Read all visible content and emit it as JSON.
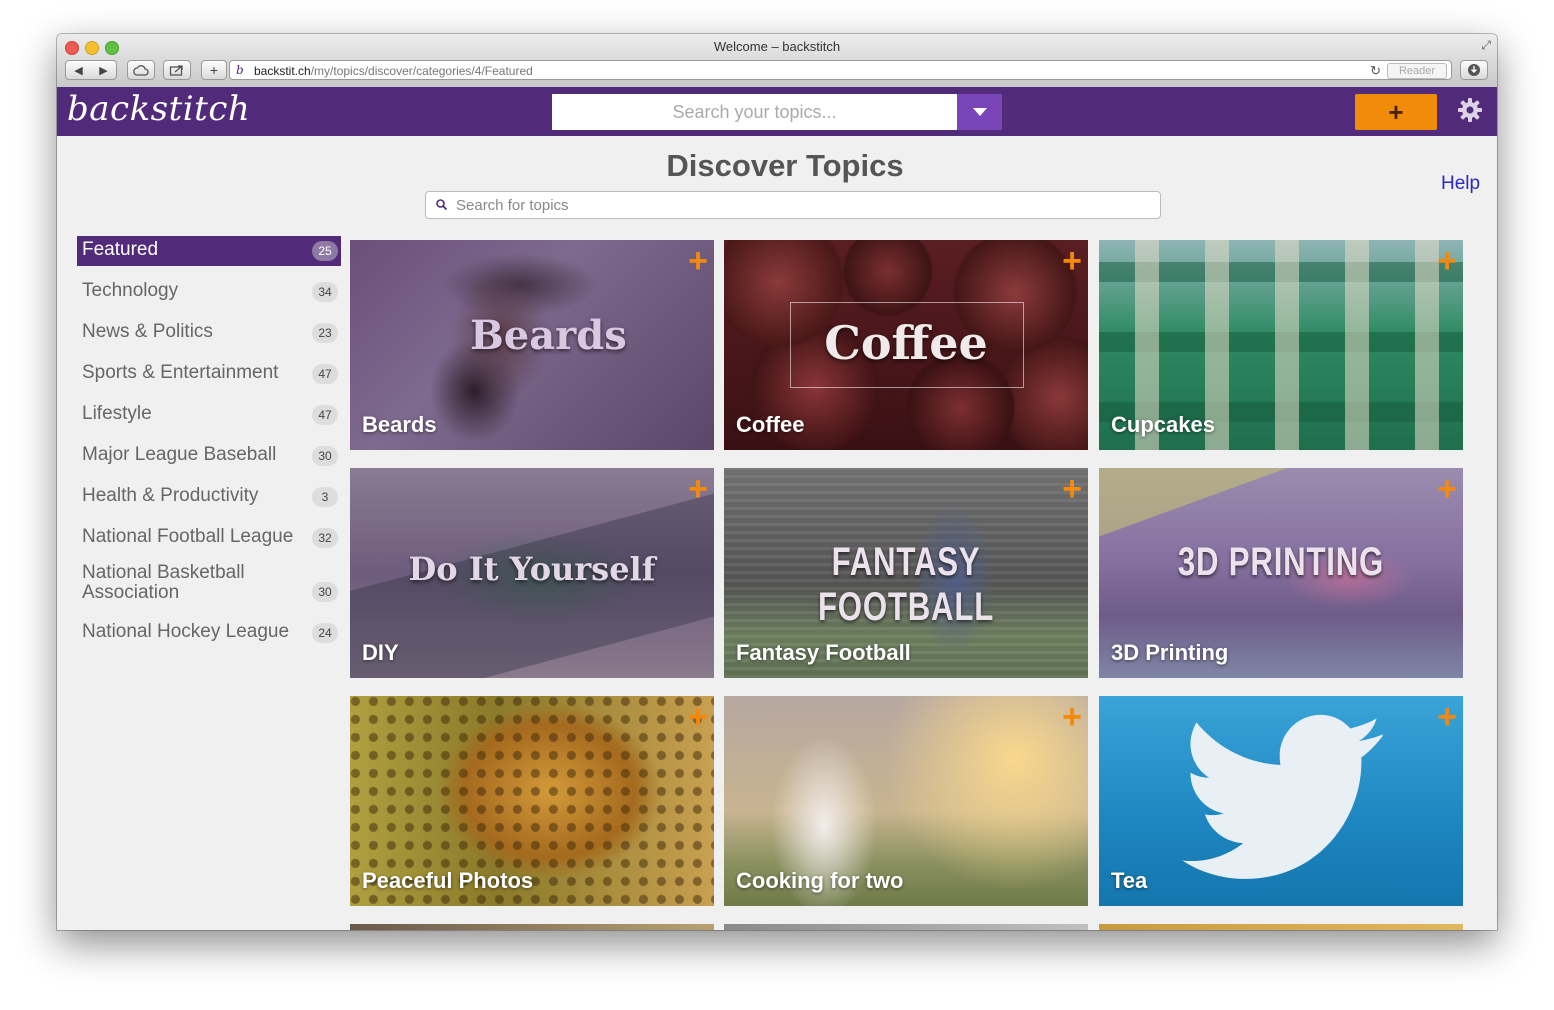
{
  "browser": {
    "window_title": "Welcome – backstitch",
    "url_host": "backstit.ch",
    "url_path": "/my/topics/discover/categories/4/Featured",
    "reader_label": "Reader",
    "back_glyph": "◀",
    "forward_glyph": "▶",
    "new_tab_glyph": "+"
  },
  "app": {
    "logo_text": "backstitch",
    "search_placeholder": "Search your topics...",
    "add_label": "+",
    "brand_color": "#512a7a",
    "accent_color": "#f18c0a"
  },
  "page": {
    "title": "Discover Topics",
    "help_label": "Help",
    "topic_search_placeholder": "Search for topics"
  },
  "categories": [
    {
      "label": "Featured",
      "count": "25"
    },
    {
      "label": "Technology",
      "count": "34"
    },
    {
      "label": "News & Politics",
      "count": "23"
    },
    {
      "label": "Sports & Entertainment",
      "count": "47"
    },
    {
      "label": "Lifestyle",
      "count": "47"
    },
    {
      "label": "Major League Baseball",
      "count": "30"
    },
    {
      "label": "Health & Productivity",
      "count": "3"
    },
    {
      "label": "National Football League",
      "count": "32"
    },
    {
      "label": "National Basketball Association",
      "count": "30"
    },
    {
      "label": "National Hockey League",
      "count": "24"
    }
  ],
  "topics": [
    {
      "caption": "Beards",
      "overlay": "Beards"
    },
    {
      "caption": "Coffee",
      "overlay": "Coffee"
    },
    {
      "caption": "Cupcakes",
      "overlay": ""
    },
    {
      "caption": "DIY",
      "overlay": "Do It Yourself"
    },
    {
      "caption": "Fantasy Football",
      "overlay": "FANTASY FOOTBALL"
    },
    {
      "caption": "3D Printing",
      "overlay": "3D PRINTING"
    },
    {
      "caption": "Peaceful Photos",
      "overlay": ""
    },
    {
      "caption": "Cooking for two",
      "overlay": ""
    },
    {
      "caption": "Tea",
      "overlay": ""
    }
  ],
  "tile_plus": "+"
}
